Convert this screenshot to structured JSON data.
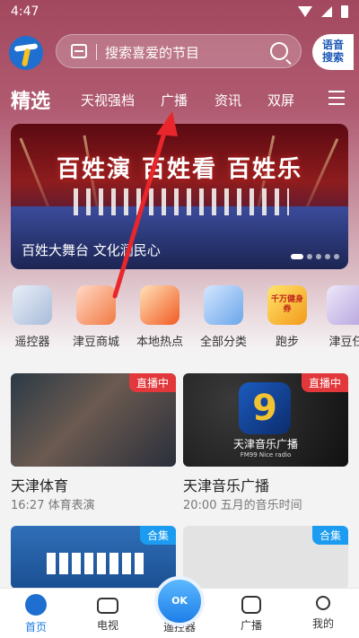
{
  "status": {
    "time": "4:47"
  },
  "search": {
    "placeholder": "搜索喜爱的节目",
    "voice_line1": "语音",
    "voice_line2": "搜索"
  },
  "nav": {
    "tabs": [
      "精选",
      "天视强档",
      "广播",
      "资讯",
      "双屏"
    ]
  },
  "banner": {
    "title": "百姓演 百姓看 百姓乐",
    "caption": "百姓大舞台 文化润民心"
  },
  "categories": [
    "遥控器",
    "津豆商城",
    "本地热点",
    "全部分类",
    "跑步",
    "津豆任"
  ],
  "promo_text": "千万健身券",
  "cards": [
    {
      "title": "天津体育",
      "subtitle": "16:27 体育表演",
      "badge": "直播中"
    },
    {
      "title": "天津音乐广播",
      "subtitle": "20:00 五月的音乐时间",
      "badge": "直播中",
      "logo_text": "天津音乐广播",
      "logo_sub": "FM99 Nice radio"
    },
    {
      "badge": "合集"
    },
    {
      "badge": "合集"
    }
  ],
  "tabbar": {
    "home": "首页",
    "tv": "电视",
    "remote": "遥控器",
    "radio": "广播",
    "mine": "我的",
    "ok": "OK"
  },
  "colors": {
    "header": "#a2485f",
    "accent": "#1b7be3",
    "live": "#e2383b",
    "collection": "#1b9cf0",
    "annotation_arrow": "#e8262b"
  }
}
